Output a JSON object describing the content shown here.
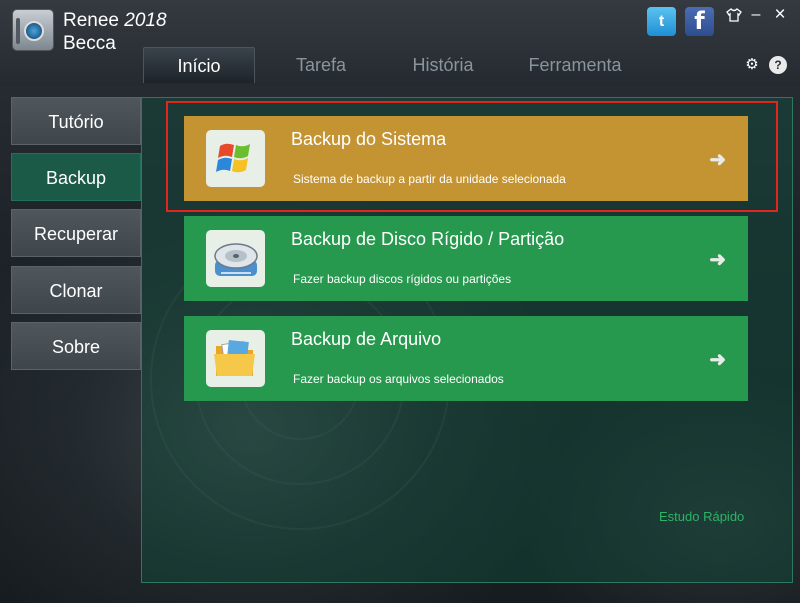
{
  "app": {
    "brand_name": "Renee",
    "brand_year": "2018",
    "brand_sub": "Becca"
  },
  "tabs": [
    {
      "label": "Início",
      "active": true
    },
    {
      "label": "Tarefa",
      "active": false
    },
    {
      "label": "História",
      "active": false
    },
    {
      "label": "Ferramenta",
      "active": false
    }
  ],
  "window_controls": {
    "skin": "shirt-icon",
    "minimize": "–",
    "close": "×",
    "settings": "⚙",
    "help": "?"
  },
  "social": {
    "twitter": "t",
    "facebook": "f"
  },
  "sidebar": {
    "items": [
      {
        "label": "Tutório",
        "active": false
      },
      {
        "label": "Backup",
        "active": true
      },
      {
        "label": "Recuperar",
        "active": false
      },
      {
        "label": "Clonar",
        "active": false
      },
      {
        "label": "Sobre",
        "active": false
      }
    ]
  },
  "cards": [
    {
      "title": "Backup do Sistema",
      "desc": "Sistema de backup a partir da unidade selecionada",
      "icon": "windows-logo-icon",
      "selected": true
    },
    {
      "title": "Backup de Disco Rígido / Partição",
      "desc": "Fazer backup discos rígidos ou partições",
      "icon": "hard-disk-icon",
      "selected": false
    },
    {
      "title": "Backup de Arquivo",
      "desc": "Fazer backup os arquivos selecionados",
      "icon": "folder-icon",
      "selected": false
    }
  ],
  "quick_link": "Estudo Rápido",
  "colors": {
    "selected_card": "#c49433",
    "card": "#27994f",
    "highlight_border": "#e0261f",
    "active_sidebar": "#1b5a47"
  }
}
